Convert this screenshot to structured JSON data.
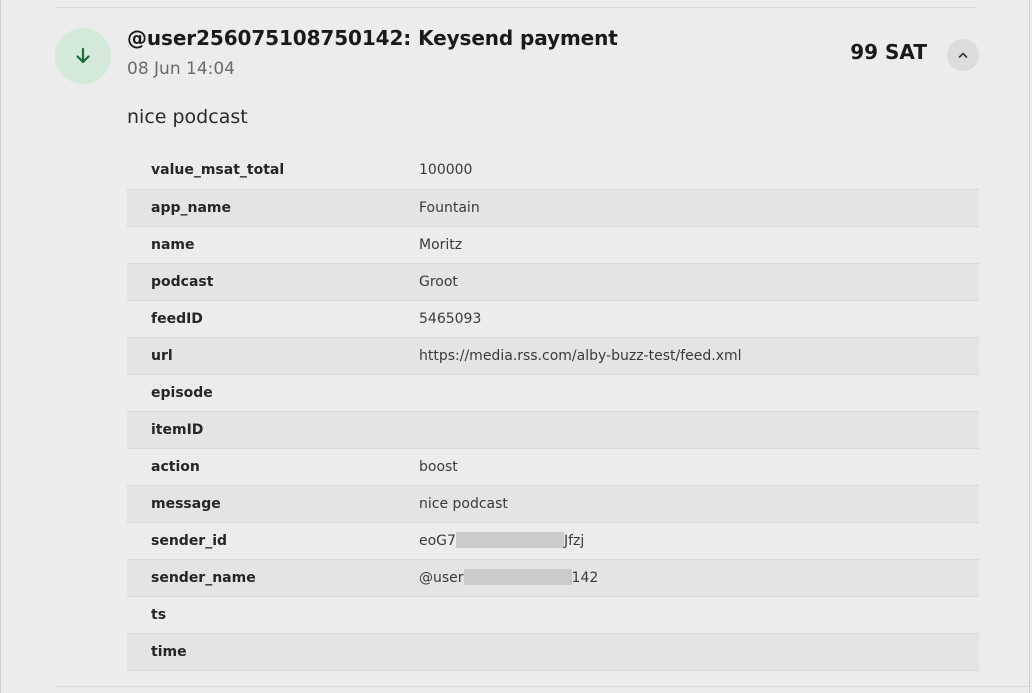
{
  "transaction": {
    "title": "@user256075108750142: Keysend payment",
    "date": "08 Jun 14:04",
    "amount": "99 SAT",
    "description": "nice podcast",
    "icon": "arrow-down-icon",
    "toggle_icon": "chevron-up-icon"
  },
  "metadata": [
    {
      "key": "value_msat_total",
      "value": "100000"
    },
    {
      "key": "app_name",
      "value": "Fountain"
    },
    {
      "key": "name",
      "value": "Moritz"
    },
    {
      "key": "podcast",
      "value": "Groot"
    },
    {
      "key": "feedID",
      "value": "5465093"
    },
    {
      "key": "url",
      "value": "https://media.rss.com/alby-buzz-test/feed.xml"
    },
    {
      "key": "episode",
      "value": ""
    },
    {
      "key": "itemID",
      "value": ""
    },
    {
      "key": "action",
      "value": "boost"
    },
    {
      "key": "message",
      "value": "nice podcast"
    },
    {
      "key": "sender_id",
      "value_prefix": "eoG7",
      "value_suffix": "Jfzj"
    },
    {
      "key": "sender_name",
      "value_prefix": "@user",
      "value_suffix": "142"
    },
    {
      "key": "ts",
      "value": ""
    },
    {
      "key": "time",
      "value": ""
    }
  ],
  "colors": {
    "icon_bg": "#d3eadb",
    "icon_arrow": "#1e6b3c",
    "background": "#ececec",
    "row_alt": "#e4e4e4"
  }
}
